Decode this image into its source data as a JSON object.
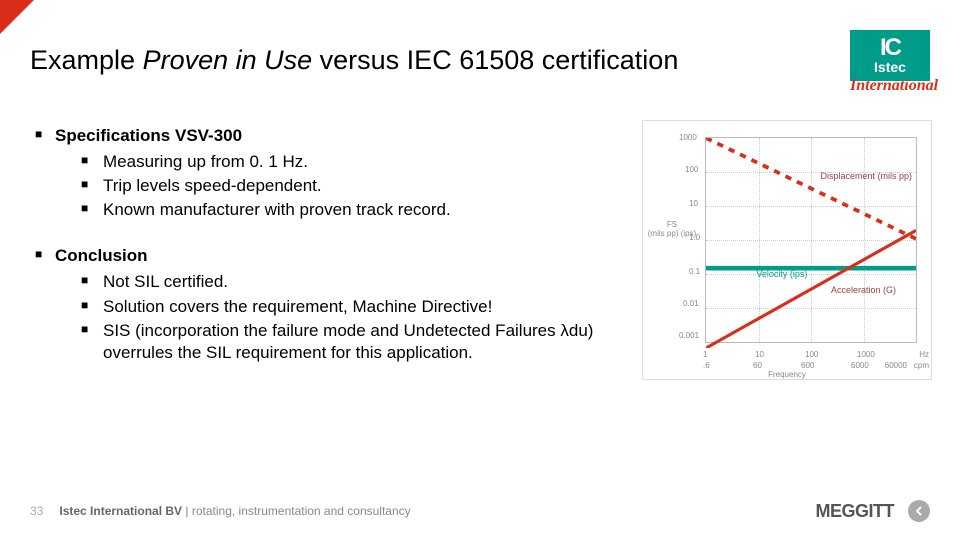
{
  "title_pre": "Example ",
  "title_em": "Proven in Use",
  "title_post": " versus IEC 61508 certification",
  "logo": {
    "ic": "IC",
    "istec": "Istec",
    "intl": "International"
  },
  "bullets": [
    {
      "heading": "Specifications VSV-300",
      "items": [
        "Measuring up from 0. 1 Hz.",
        "Trip levels speed-dependent.",
        "Known manufacturer with proven track record."
      ]
    },
    {
      "heading": "Conclusion",
      "items": [
        "Not SIL certified.",
        "Solution covers the requirement, Machine Directive!",
        "SIS (incorporation the failure mode and Undetected Failures λdu) overrules the SIL requirement for this application."
      ]
    }
  ],
  "chart_data": {
    "type": "line",
    "xlabel": "Frequency",
    "x_units_top": "Hz",
    "x_units_bottom": "cpm",
    "ylabel": "FS",
    "y_units_top": "(mils pp) (ips)",
    "x_ticks_hz": [
      "1",
      "10",
      "100",
      "1000"
    ],
    "x_ticks_cpm": [
      ".6",
      "60",
      "600",
      "6000",
      "60000"
    ],
    "y_ticks": [
      "0.001",
      "0.01",
      "0.1",
      "1.0",
      "10",
      "100",
      "1000"
    ],
    "series": [
      {
        "name": "Displacement (mils pp)",
        "color": "#d92f1a",
        "dash": true,
        "points": [
          [
            1,
            1000
          ],
          [
            1000,
            1.0
          ]
        ]
      },
      {
        "name": "Velocity (ips)",
        "color": "#009c8a",
        "dash": false,
        "points": [
          [
            1,
            0.15
          ],
          [
            1000,
            0.15
          ]
        ]
      },
      {
        "name": "Acceleration (G)",
        "color": "#d92f1a",
        "dash": false,
        "points": [
          [
            1,
            0.001
          ],
          [
            1000,
            1.2
          ]
        ]
      }
    ],
    "legend_labels": [
      "Displacement (mils pp)",
      "Velocity (ips)",
      "Acceleration (G)"
    ]
  },
  "footer": {
    "page": "33",
    "company": "Istec International BV",
    "sep": " | ",
    "tagline": "rotating, instrumentation and consultancy",
    "partner": "MEGGITT"
  }
}
